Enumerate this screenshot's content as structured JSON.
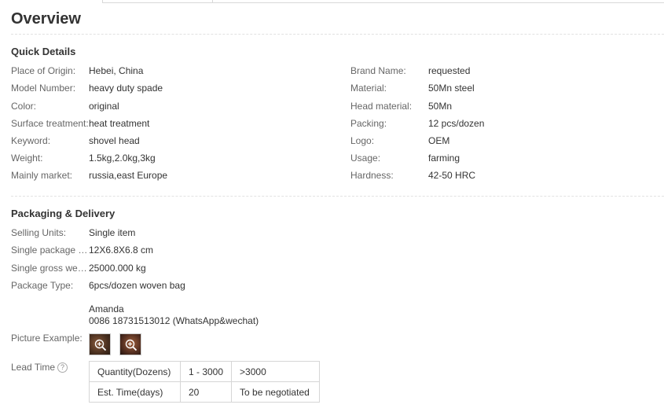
{
  "title": "Overview",
  "quick_details": {
    "heading": "Quick Details",
    "left": [
      {
        "label": "Place of Origin:",
        "value": "Hebei, China"
      },
      {
        "label": "Model Number:",
        "value": "heavy duty spade"
      },
      {
        "label": "Color:",
        "value": "original"
      },
      {
        "label": "Surface treatment:",
        "value": "heat treatment"
      },
      {
        "label": "Keyword:",
        "value": "shovel head"
      },
      {
        "label": "Weight:",
        "value": "1.5kg,2.0kg,3kg"
      },
      {
        "label": "Mainly market:",
        "value": "russia,east Europe"
      }
    ],
    "right": [
      {
        "label": "Brand Name:",
        "value": "requested"
      },
      {
        "label": "Material:",
        "value": "50Mn steel"
      },
      {
        "label": "Head material:",
        "value": "50Mn"
      },
      {
        "label": "Packing:",
        "value": "12 pcs/dozen"
      },
      {
        "label": "Logo:",
        "value": "OEM"
      },
      {
        "label": "Usage:",
        "value": "farming"
      },
      {
        "label": "Hardness:",
        "value": "42-50 HRC"
      }
    ]
  },
  "packaging": {
    "heading": "Packaging & Delivery",
    "rows": [
      {
        "label": "Selling Units:",
        "value": "Single item"
      },
      {
        "label": "Single package size:",
        "value": "12X6.8X6.8 cm"
      },
      {
        "label": "Single gross weight:",
        "value": "25000.000 kg"
      },
      {
        "label": "Package Type:",
        "value": "6pcs/dozen woven bag"
      }
    ],
    "contact_name": "Amanda",
    "contact_phone": "0086 18731513012 (WhatsApp&wechat)",
    "picture_label": "Picture Example:",
    "picture_icons": [
      "zoom-in-icon",
      "zoom-in-icon"
    ],
    "lead_time_label": "Lead Time",
    "lead_time_help_icon": "question-mark-icon",
    "lead_table": {
      "row1": [
        "Quantity(Dozens)",
        "1 - 3000",
        ">3000"
      ],
      "row2": [
        "Est. Time(days)",
        "20",
        "To be negotiated"
      ]
    }
  }
}
